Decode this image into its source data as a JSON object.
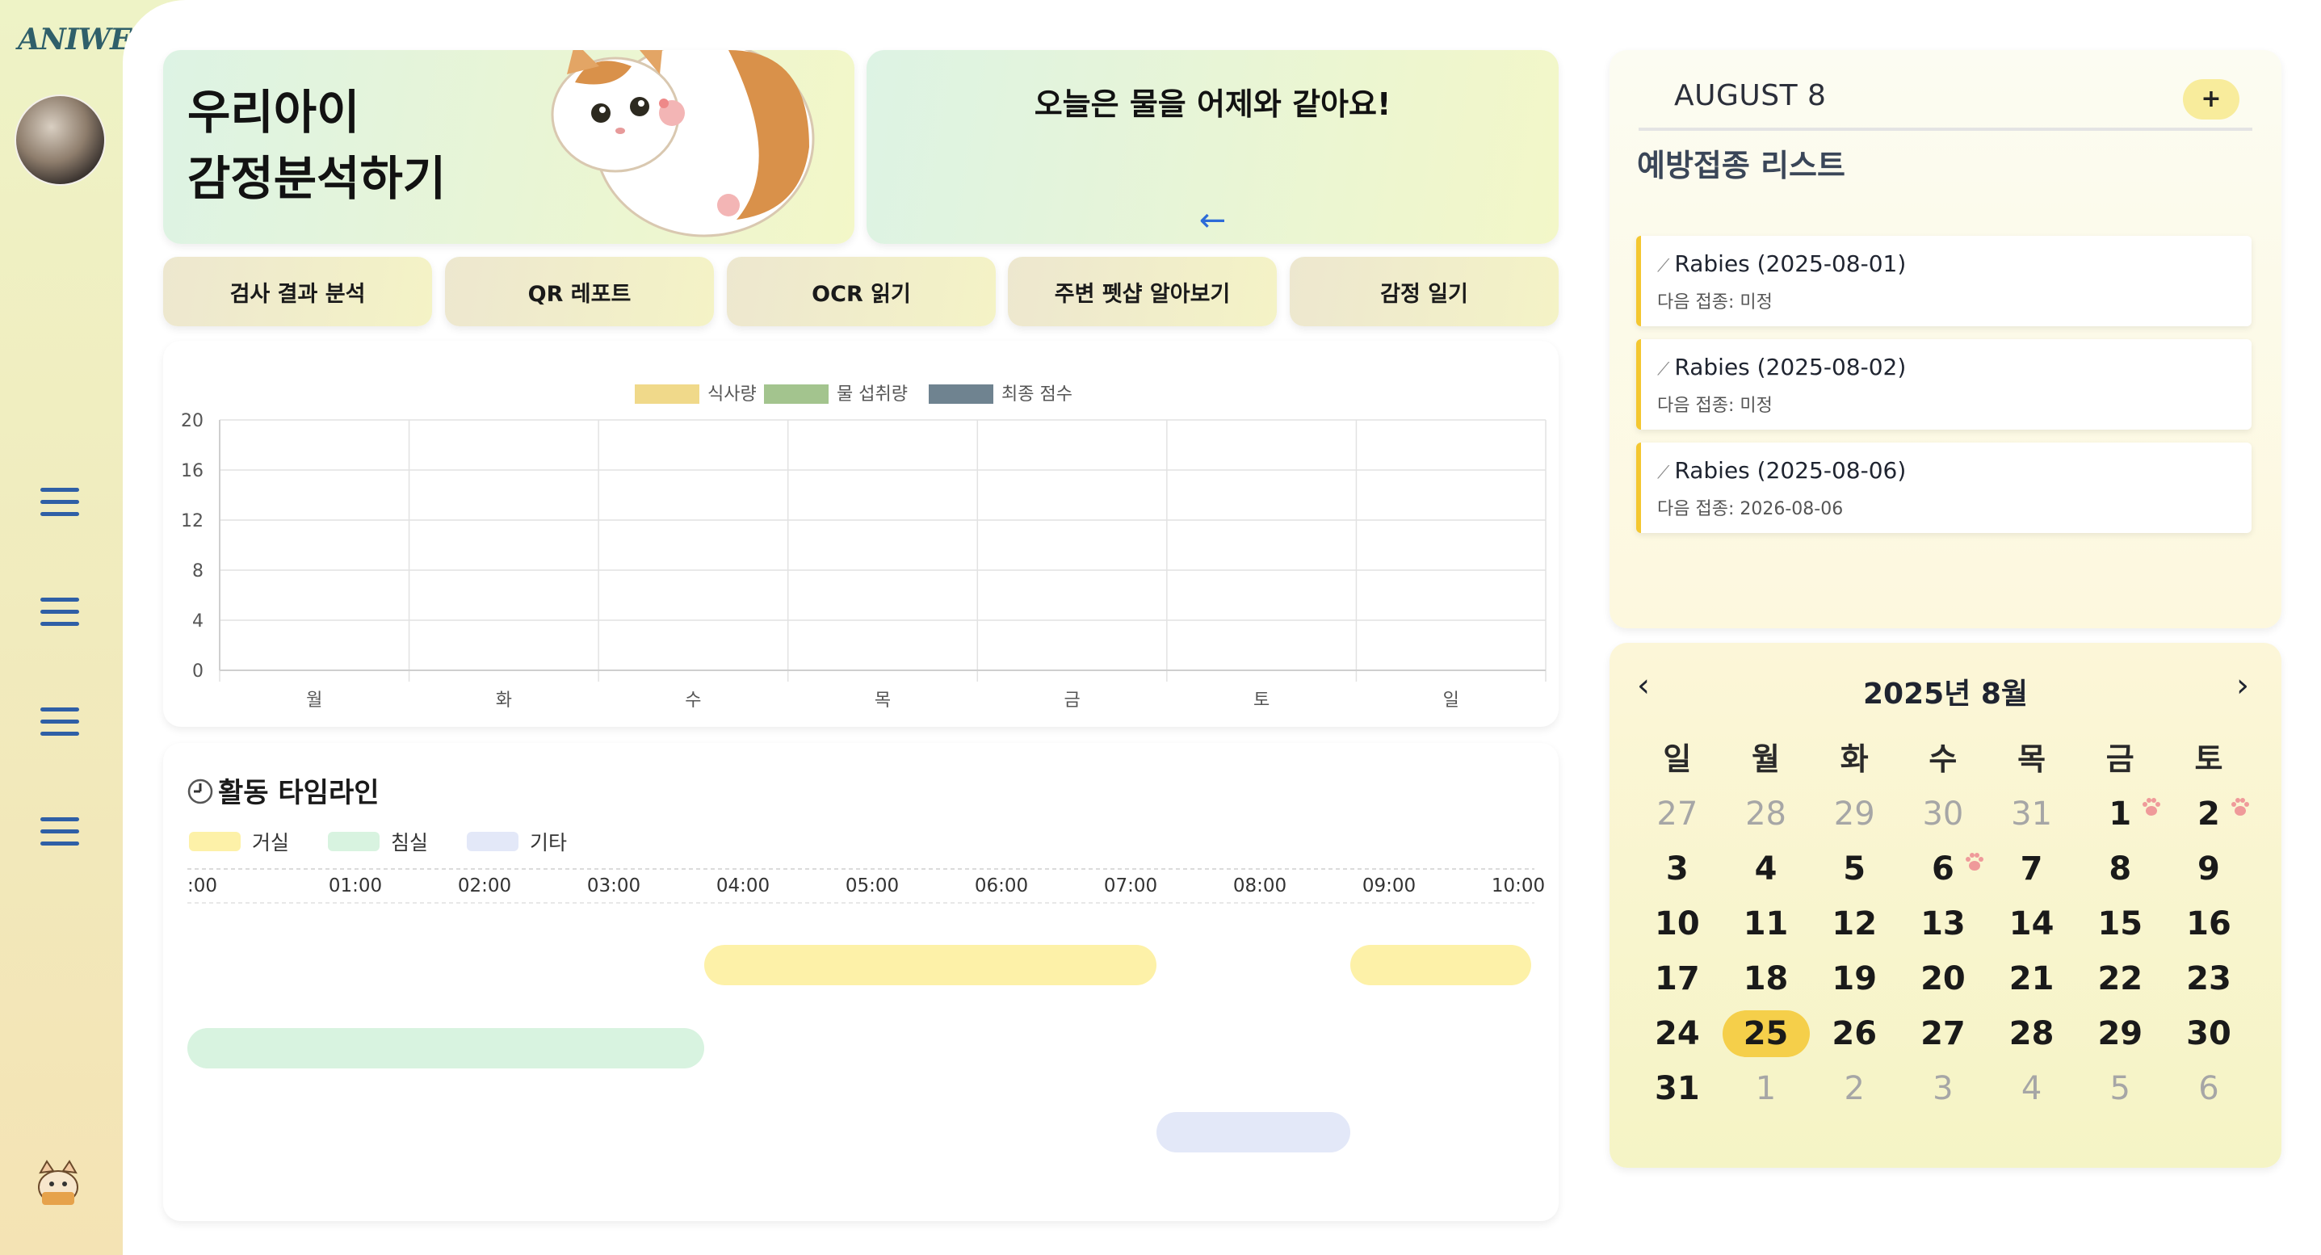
{
  "app": {
    "logo": "ANIWELL"
  },
  "sidebar": {
    "menu_count": 4
  },
  "hero": {
    "line1": "우리아이",
    "line2": "감정분석하기"
  },
  "water": {
    "text": "오늘은 물을 어제와 같아요!",
    "arrow": "←"
  },
  "tabs": [
    {
      "label": "검사 결과 분석"
    },
    {
      "label": "QR 레포트"
    },
    {
      "label": "OCR 읽기"
    },
    {
      "label": "주변 펫샵 알아보기"
    },
    {
      "label": "감정 일기"
    }
  ],
  "chart_data": {
    "type": "bar",
    "categories": [
      "월",
      "화",
      "수",
      "목",
      "금",
      "토",
      "일"
    ],
    "series": [
      {
        "name": "식사량",
        "values": [
          0,
          0,
          0,
          0,
          0,
          0,
          0
        ],
        "color": "#f0d98a"
      },
      {
        "name": "물 섭취량",
        "values": [
          0,
          0,
          0,
          0,
          0,
          0,
          0
        ],
        "color": "#a3c48e"
      },
      {
        "name": "최종 점수",
        "values": [
          0,
          0,
          0,
          0,
          0,
          0,
          0
        ],
        "color": "#6f8390"
      }
    ],
    "ylim": [
      0,
      20
    ],
    "yticks": [
      "0",
      "4",
      "8",
      "12",
      "16",
      "20"
    ],
    "legend": "top",
    "grid": true
  },
  "timeline": {
    "title": "활동 타임라인",
    "clock_icon": "clock-icon",
    "legend": [
      {
        "label": "거실",
        "color": "#fdf1a8"
      },
      {
        "label": "침실",
        "color": "#d8f3e0"
      },
      {
        "label": "기타",
        "color": "#e3e8f8"
      }
    ],
    "hours": [
      ":00",
      "01:00",
      "02:00",
      "03:00",
      "04:00",
      "05:00",
      "06:00",
      "07:00",
      "08:00",
      "09:00",
      "10:00"
    ],
    "bars": [
      {
        "room": "거실",
        "start": 4.0,
        "end": 7.5
      },
      {
        "room": "거실",
        "start": 9.0,
        "end": 10.4
      },
      {
        "room": "침실",
        "start": 0.0,
        "end": 4.0
      },
      {
        "room": "기타",
        "start": 7.5,
        "end": 9.0
      }
    ]
  },
  "vaccination": {
    "date": "AUGUST 8",
    "add_label": "+",
    "title": "예방접종 리스트",
    "items": [
      {
        "name": "Rabies (2025-08-01)",
        "next": "다음 접종: 미정"
      },
      {
        "name": "Rabies (2025-08-02)",
        "next": "다음 접종: 미정"
      },
      {
        "name": "Rabies (2025-08-06)",
        "next": "다음 접종: 2026-08-06"
      }
    ],
    "icon": "syringe-icon"
  },
  "calendar": {
    "title": "2025년 8월",
    "prev": "‹",
    "next": "›",
    "weekdays": [
      "일",
      "월",
      "화",
      "수",
      "목",
      "금",
      "토"
    ],
    "weeks": [
      [
        {
          "d": "27",
          "o": true
        },
        {
          "d": "28",
          "o": true
        },
        {
          "d": "29",
          "o": true
        },
        {
          "d": "30",
          "o": true
        },
        {
          "d": "31",
          "o": true
        },
        {
          "d": "1",
          "paw": true
        },
        {
          "d": "2",
          "paw": true
        }
      ],
      [
        {
          "d": "3"
        },
        {
          "d": "4"
        },
        {
          "d": "5"
        },
        {
          "d": "6",
          "paw": true
        },
        {
          "d": "7"
        },
        {
          "d": "8"
        },
        {
          "d": "9"
        }
      ],
      [
        {
          "d": "10"
        },
        {
          "d": "11"
        },
        {
          "d": "12"
        },
        {
          "d": "13"
        },
        {
          "d": "14"
        },
        {
          "d": "15"
        },
        {
          "d": "16"
        }
      ],
      [
        {
          "d": "17"
        },
        {
          "d": "18"
        },
        {
          "d": "19"
        },
        {
          "d": "20"
        },
        {
          "d": "21"
        },
        {
          "d": "22"
        },
        {
          "d": "23"
        }
      ],
      [
        {
          "d": "24"
        },
        {
          "d": "25",
          "today": true
        },
        {
          "d": "26"
        },
        {
          "d": "27"
        },
        {
          "d": "28"
        },
        {
          "d": "29"
        },
        {
          "d": "30"
        }
      ],
      [
        {
          "d": "31"
        },
        {
          "d": "1",
          "o": true
        },
        {
          "d": "2",
          "o": true
        },
        {
          "d": "3",
          "o": true
        },
        {
          "d": "4",
          "o": true
        },
        {
          "d": "5",
          "o": true
        },
        {
          "d": "6",
          "o": true
        }
      ]
    ]
  }
}
